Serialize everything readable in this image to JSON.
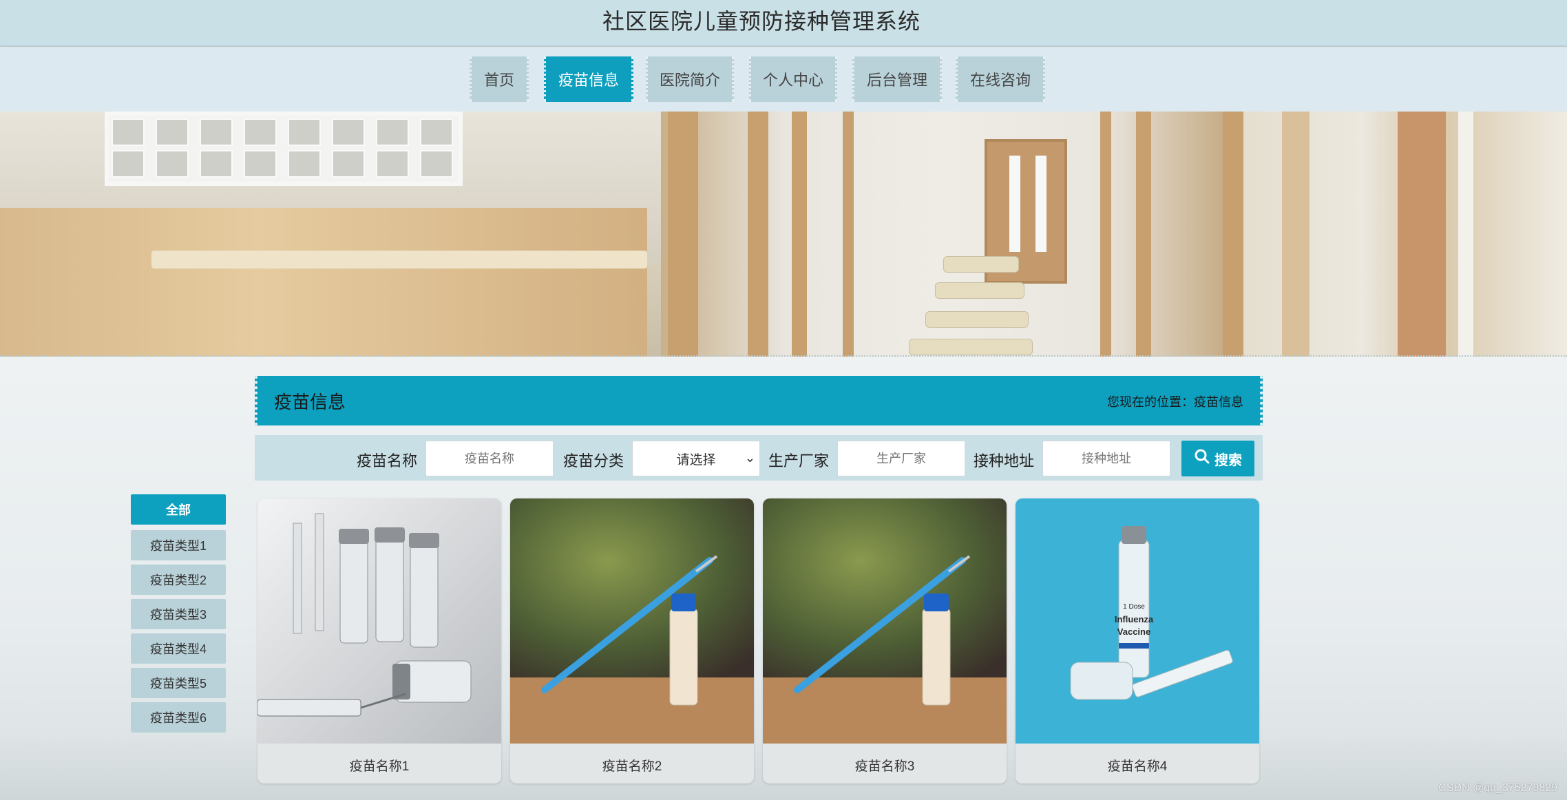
{
  "header": {
    "title": "社区医院儿童预防接种管理系统"
  },
  "nav": {
    "items": [
      {
        "label": "首页",
        "active": false
      },
      {
        "label": "疫苗信息",
        "active": true
      },
      {
        "label": "医院简介",
        "active": false
      },
      {
        "label": "个人中心",
        "active": false
      },
      {
        "label": "后台管理",
        "active": false
      },
      {
        "label": "在线咨询",
        "active": false
      }
    ]
  },
  "section": {
    "title": "疫苗信息",
    "breadcrumb": "您现在的位置：疫苗信息"
  },
  "search": {
    "name_label": "疫苗名称",
    "name_placeholder": "疫苗名称",
    "category_label": "疫苗分类",
    "category_selected": "请选择",
    "maker_label": "生产厂家",
    "maker_placeholder": "生产厂家",
    "address_label": "接种地址",
    "address_placeholder": "接种地址",
    "button_label": "搜索"
  },
  "categories": [
    {
      "label": "全部",
      "active": true
    },
    {
      "label": "疫苗类型1",
      "active": false
    },
    {
      "label": "疫苗类型2",
      "active": false
    },
    {
      "label": "疫苗类型3",
      "active": false
    },
    {
      "label": "疫苗类型4",
      "active": false
    },
    {
      "label": "疫苗类型5",
      "active": false
    },
    {
      "label": "疫苗类型6",
      "active": false
    }
  ],
  "cards": [
    {
      "name": "疫苗名称1",
      "image": "vials-and-syringe"
    },
    {
      "name": "疫苗名称2",
      "image": "syringe-and-vial"
    },
    {
      "name": "疫苗名称3",
      "image": "syringe-and-vial"
    },
    {
      "name": "疫苗名称4",
      "image": "influenza-vaccine-vial"
    }
  ],
  "card4_vial_text": {
    "line1": "1 Dose",
    "line2": "Influenza",
    "line3": "Vaccine"
  },
  "watermark": "CSDN @qq_375279829",
  "colors": {
    "accent": "#0ea0bf",
    "nav_bg": "#b9d2d9",
    "header_bg": "#c9e0e7"
  }
}
